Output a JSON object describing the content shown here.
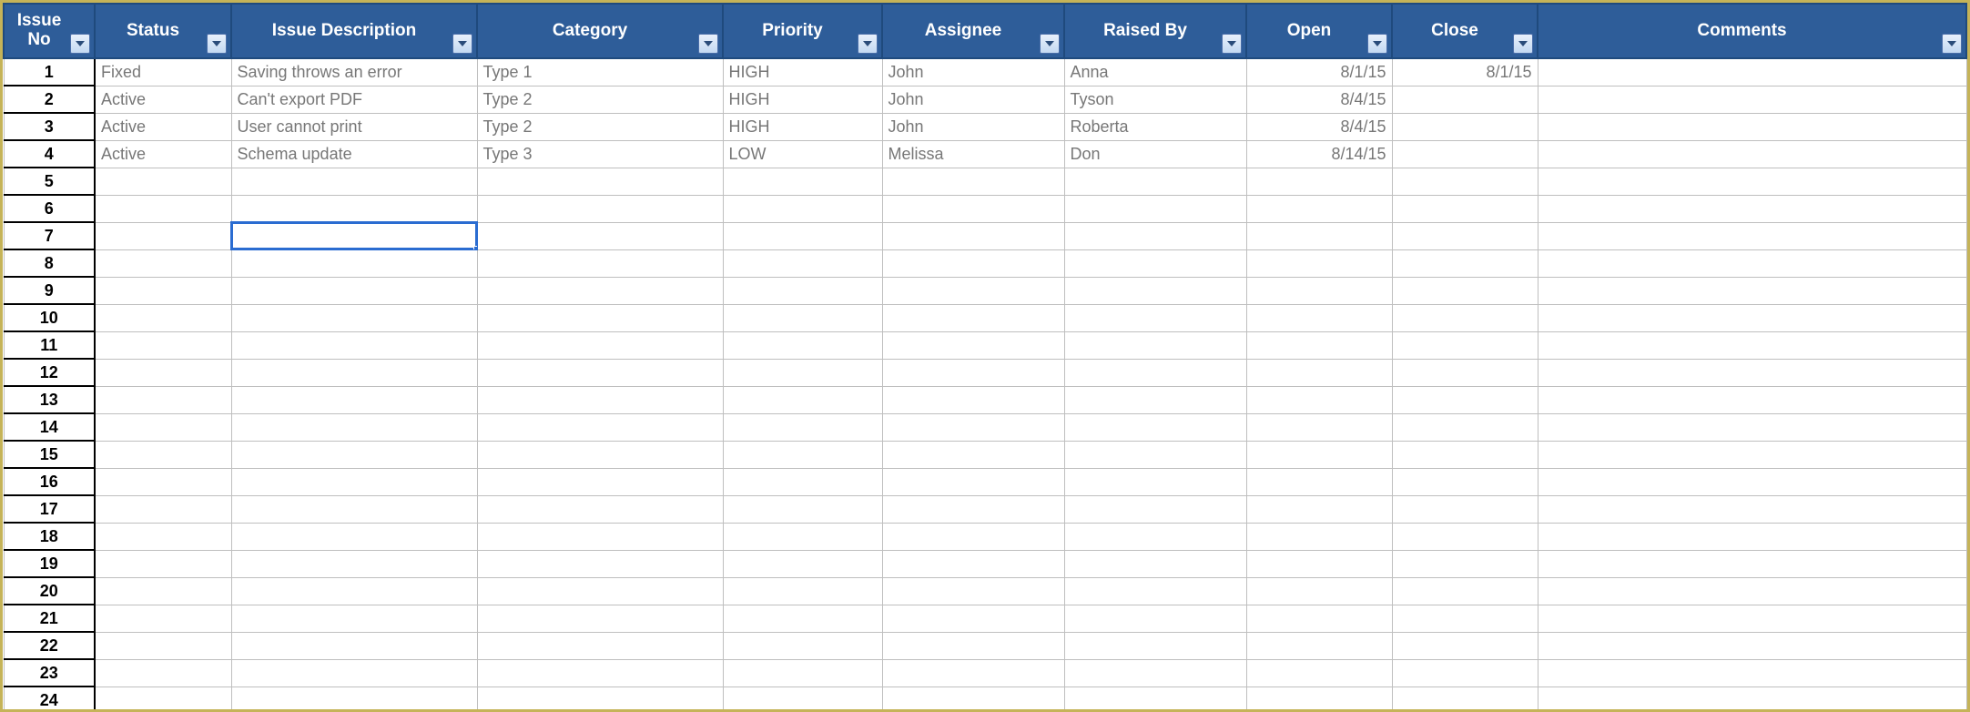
{
  "columns": [
    {
      "key": "no",
      "label": "Issue No"
    },
    {
      "key": "status",
      "label": "Status"
    },
    {
      "key": "desc",
      "label": "Issue Description"
    },
    {
      "key": "category",
      "label": "Category"
    },
    {
      "key": "priority",
      "label": "Priority"
    },
    {
      "key": "assignee",
      "label": "Assignee"
    },
    {
      "key": "raised",
      "label": "Raised By"
    },
    {
      "key": "open",
      "label": "Open"
    },
    {
      "key": "close",
      "label": "Close"
    },
    {
      "key": "comments",
      "label": "Comments"
    }
  ],
  "rowNumbers": [
    1,
    2,
    3,
    4,
    5,
    6,
    7,
    8,
    9,
    10,
    11,
    12,
    13,
    14,
    15,
    16,
    17,
    18,
    19,
    20,
    21,
    22,
    23,
    24
  ],
  "rows": [
    {
      "no": 1,
      "status": "Fixed",
      "desc": "Saving throws an error",
      "category": "Type 1",
      "priority": "HIGH",
      "assignee": "John",
      "raised": "Anna",
      "open": "8/1/15",
      "close": "8/1/15",
      "comments": ""
    },
    {
      "no": 2,
      "status": "Active",
      "desc": "Can't export PDF",
      "category": "Type 2",
      "priority": "HIGH",
      "assignee": "John",
      "raised": "Tyson",
      "open": "8/4/15",
      "close": "",
      "comments": ""
    },
    {
      "no": 3,
      "status": "Active",
      "desc": "User cannot print",
      "category": "Type 2",
      "priority": "HIGH",
      "assignee": "John",
      "raised": "Roberta",
      "open": "8/4/15",
      "close": "",
      "comments": ""
    },
    {
      "no": 4,
      "status": "Active",
      "desc": "Schema update",
      "category": "Type 3",
      "priority": "LOW",
      "assignee": "Melissa",
      "raised": "Don",
      "open": "8/14/15",
      "close": "",
      "comments": ""
    }
  ],
  "selectedCell": {
    "row": 7,
    "col": "desc"
  }
}
